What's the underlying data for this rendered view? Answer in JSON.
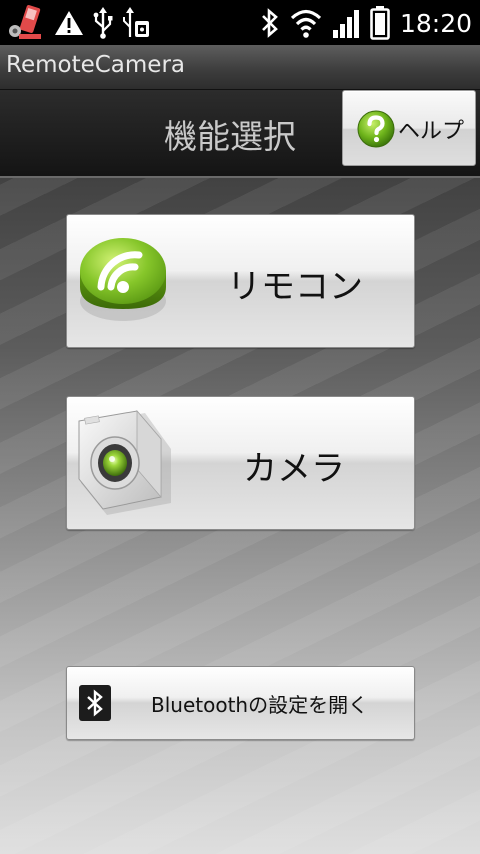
{
  "status_bar": {
    "time": "18:20",
    "left_icons": [
      "flip-phone-icon",
      "warning-icon",
      "usb-icon",
      "usb-debug-icon"
    ],
    "right_icons": [
      "bluetooth-icon",
      "wifi-icon",
      "signal-icon",
      "battery-icon"
    ]
  },
  "app": {
    "title": "RemoteCamera"
  },
  "header": {
    "title": "機能選択",
    "help_label": "ヘルプ"
  },
  "main": {
    "remote_label": "リモコン",
    "camera_label": "カメラ",
    "bluetooth_label": "Bluetoothの設定を開く"
  },
  "colors": {
    "accent_green": "#7fc51f",
    "header_bg": "#1a1a1a"
  }
}
